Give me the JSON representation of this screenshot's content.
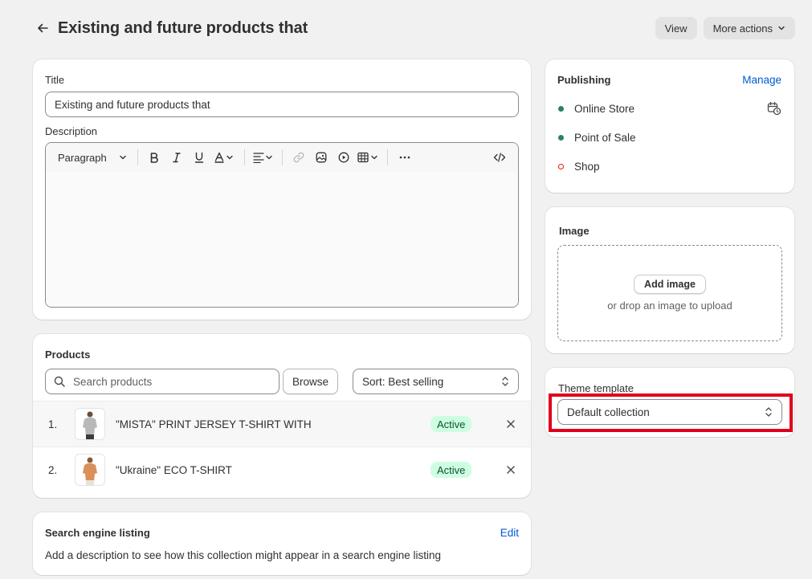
{
  "header": {
    "title": "Existing and future products that",
    "view_label": "View",
    "more_actions_label": "More actions"
  },
  "details": {
    "title_label": "Title",
    "title_value": "Existing and future products that",
    "description_label": "Description",
    "toolbar": {
      "paragraph_label": "Paragraph"
    }
  },
  "products": {
    "heading": "Products",
    "search_placeholder": "Search products",
    "browse_label": "Browse",
    "sort_label": "Sort: Best selling",
    "items": [
      {
        "num": "1.",
        "name": "\"MISTA\" PRINT JERSEY T-SHIRT WITH",
        "status": "Active",
        "shirt_color": "#b9b9b9"
      },
      {
        "num": "2.",
        "name": "\"Ukraine\" ECO T-SHIRT",
        "status": "Active",
        "shirt_color": "#d9905a"
      }
    ]
  },
  "seo": {
    "heading": "Search engine listing",
    "edit_label": "Edit",
    "description": "Add a description to see how this collection might appear in a search engine listing"
  },
  "publishing": {
    "heading": "Publishing",
    "manage_label": "Manage",
    "channels": [
      {
        "name": "Online Store",
        "status_color": "#29845a"
      },
      {
        "name": "Point of Sale",
        "status_color": "#29845a"
      },
      {
        "name": "Shop",
        "status_color": "#e51c00"
      }
    ]
  },
  "image": {
    "heading": "Image",
    "add_label": "Add image",
    "hint": "or drop an image to upload"
  },
  "theme": {
    "label": "Theme template",
    "value": "Default collection"
  },
  "colors": {
    "accent_link": "#005bd3",
    "badge_bg": "#cdfee1",
    "highlight": "#e0001b"
  }
}
